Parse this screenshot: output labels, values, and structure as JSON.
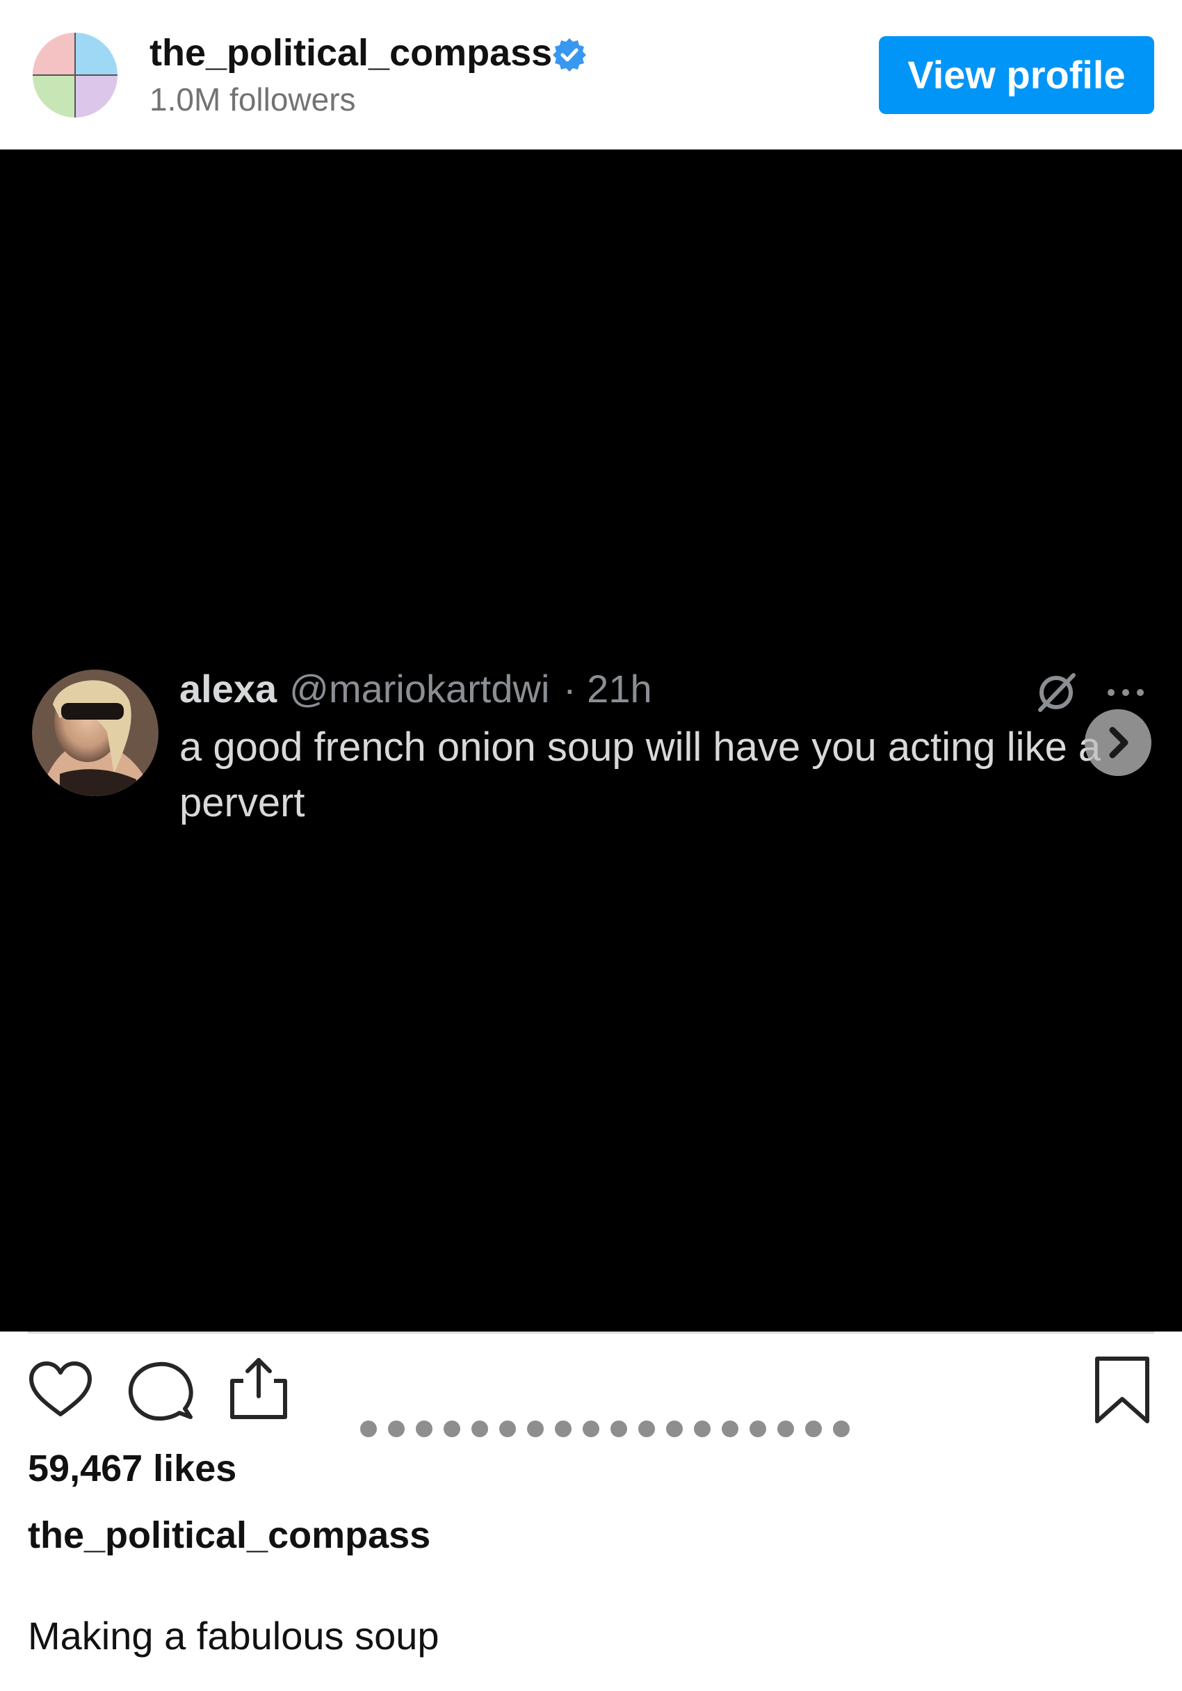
{
  "header": {
    "account_name": "the_political_compass",
    "verified": true,
    "followers": "1.0M followers",
    "view_profile_label": "View profile",
    "avatar_icon": "political-compass-logo-icon",
    "avatar_colors": [
      "#f4c2c2",
      "#9fd8f5",
      "#c8e6b5",
      "#dcc6ea"
    ]
  },
  "post": {
    "media": {
      "background_color": "#000000",
      "tweet": {
        "name": "alexa",
        "handle": "@mariokartdwi",
        "time": "· 21h",
        "text_lines": [
          "a good french onion soup will have you acting like a",
          "pervert"
        ]
      },
      "carousel": {
        "total_slides": 19,
        "current_slide": 1
      }
    },
    "actions": {
      "like_icon": "heart-icon",
      "comment_icon": "comment-icon",
      "share_icon": "share-icon",
      "save_icon": "bookmark-icon"
    },
    "likes": "59,467 likes",
    "caption": {
      "author": "the_political_compass",
      "text": "Making a fabulous soup"
    }
  },
  "colors": {
    "accent": "#0095f6",
    "verified": "#3897f0",
    "muted_text": "#737373"
  }
}
